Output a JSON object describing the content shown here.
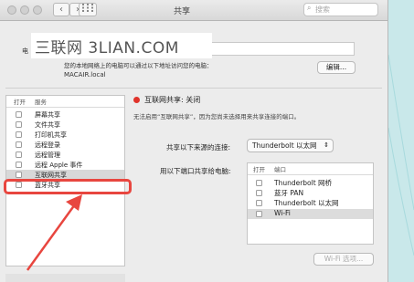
{
  "window": {
    "title": "共享"
  },
  "search": {
    "placeholder": "搜索"
  },
  "watermark": {
    "text": "三联网 3LIAN.COM"
  },
  "computer": {
    "name_label": "电",
    "access_note": "您的本地网络上的电脑可以通过以下地址访问您的电脑：",
    "local_address": "MACAIR.local",
    "edit_label": "编辑..."
  },
  "services": {
    "header_on": "打开",
    "header_service": "服务",
    "items": [
      {
        "label": "屏幕共享",
        "checked": false
      },
      {
        "label": "文件共享",
        "checked": false
      },
      {
        "label": "打印机共享",
        "checked": false
      },
      {
        "label": "远程登录",
        "checked": false
      },
      {
        "label": "远程管理",
        "checked": false
      },
      {
        "label": "远程 Apple 事件",
        "checked": false
      },
      {
        "label": "互联网共享",
        "checked": false,
        "selected": true
      },
      {
        "label": "蓝牙共享",
        "checked": false
      }
    ]
  },
  "detail": {
    "status_text": "互联网共享: 关闭",
    "status_color": "#e0332b",
    "description": "无法启用“互联网共享”，因为您尚未选择用来共享连接的端口。",
    "share_from_label": "共享以下来源的连接:",
    "share_from_value": "Thunderbolt 以太网",
    "to_ports_label": "用以下端口共享给电脑:",
    "ports_header_on": "打开",
    "ports_header_port": "端口",
    "ports": [
      {
        "label": "Thunderbolt 网桥",
        "checked": false
      },
      {
        "label": "蓝牙 PAN",
        "checked": false
      },
      {
        "label": "Thunderbolt 以太网",
        "checked": false
      },
      {
        "label": "Wi-Fi",
        "checked": false,
        "selected": true
      }
    ],
    "wifi_options_label": "Wi-Fi 选项..."
  },
  "annotation": {
    "highlight_color": "#e8463f"
  }
}
